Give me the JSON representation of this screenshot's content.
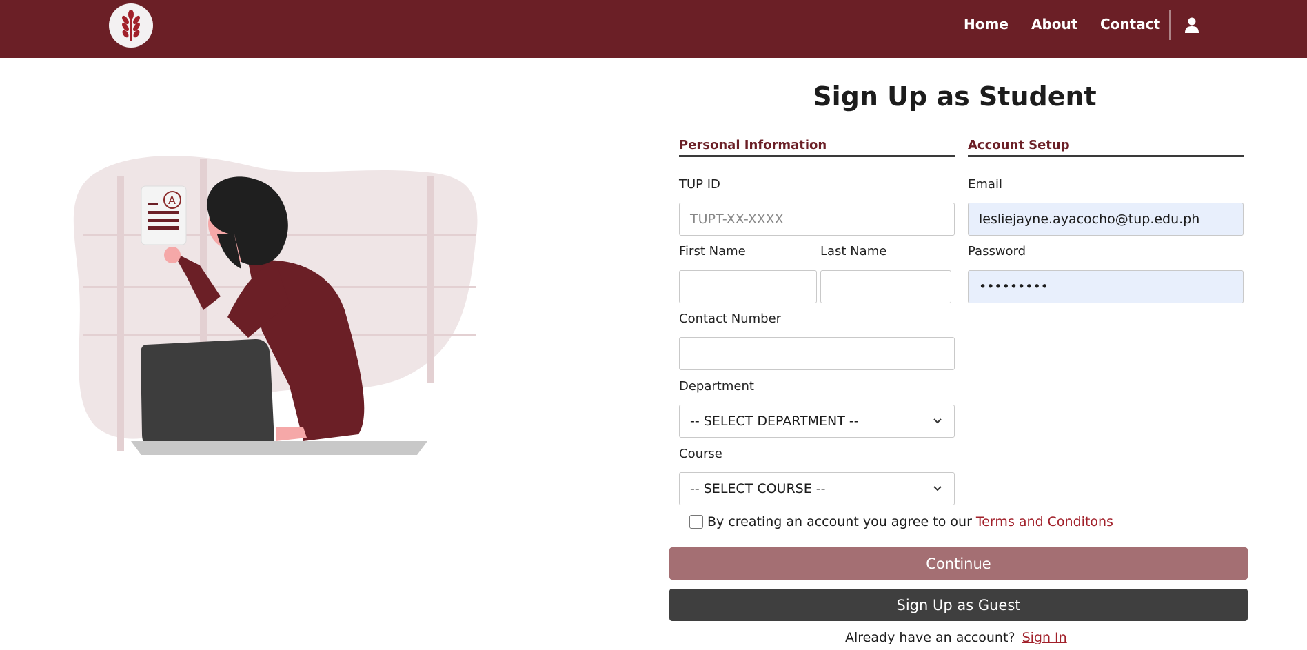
{
  "header": {
    "nav": {
      "home": "Home",
      "about": "About",
      "contact": "Contact"
    },
    "icons": {
      "logo": "wheat-leaf-logo",
      "user": "user-icon"
    },
    "brand_color": "#6b1f26"
  },
  "form": {
    "title": "Sign Up as Student",
    "sections": {
      "personal": "Personal Information",
      "account": "Account Setup"
    },
    "tup_id": {
      "label": "TUP ID",
      "placeholder": "TUPT-XX-XXXX",
      "value": ""
    },
    "first_name": {
      "label": "First Name",
      "value": ""
    },
    "last_name": {
      "label": "Last Name",
      "value": ""
    },
    "contact_number": {
      "label": "Contact Number",
      "value": ""
    },
    "department": {
      "label": "Department",
      "selected": "-- SELECT DEPARTMENT --"
    },
    "course": {
      "label": "Course",
      "selected": "-- SELECT COURSE --"
    },
    "email": {
      "label": "Email",
      "value": "lesliejayne.ayacocho@tup.edu.ph"
    },
    "password": {
      "label": "Password",
      "value": "•••••••••"
    },
    "terms": {
      "text": "By creating an account you agree to our",
      "link": "Terms and Conditons"
    },
    "continue_label": "Continue",
    "guest_label": "Sign Up as Guest",
    "signin_prompt": "Already have an account?",
    "signin_link": "Sign In"
  }
}
